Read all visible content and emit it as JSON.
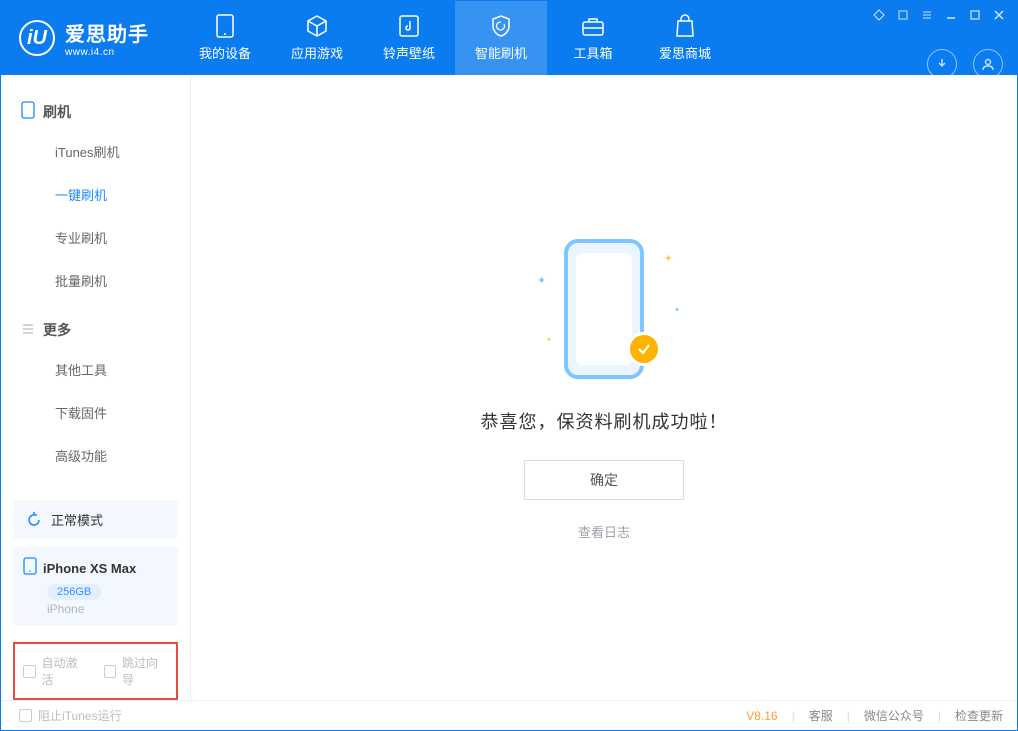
{
  "app": {
    "title": "爱思助手",
    "subtitle": "www.i4.cn"
  },
  "nav": {
    "items": [
      {
        "label": "我的设备"
      },
      {
        "label": "应用游戏"
      },
      {
        "label": "铃声壁纸"
      },
      {
        "label": "智能刷机"
      },
      {
        "label": "工具箱"
      },
      {
        "label": "爱思商城"
      }
    ]
  },
  "sidebar": {
    "section1": {
      "title": "刷机",
      "items": [
        "iTunes刷机",
        "一键刷机",
        "专业刷机",
        "批量刷机"
      ]
    },
    "section2": {
      "title": "更多",
      "items": [
        "其他工具",
        "下载固件",
        "高级功能"
      ]
    }
  },
  "device_mode": {
    "label": "正常模式"
  },
  "device_info": {
    "name": "iPhone XS Max",
    "storage": "256GB",
    "type": "iPhone"
  },
  "options": {
    "auto_activate": "自动激活",
    "skip_guide": "跳过向导"
  },
  "content": {
    "message": "恭喜您，保资料刷机成功啦！",
    "confirm": "确定",
    "view_log": "查看日志"
  },
  "footer": {
    "block_itunes": "阻止iTunes运行",
    "version": "V8.16",
    "support": "客服",
    "wechat": "微信公众号",
    "update": "检查更新"
  }
}
